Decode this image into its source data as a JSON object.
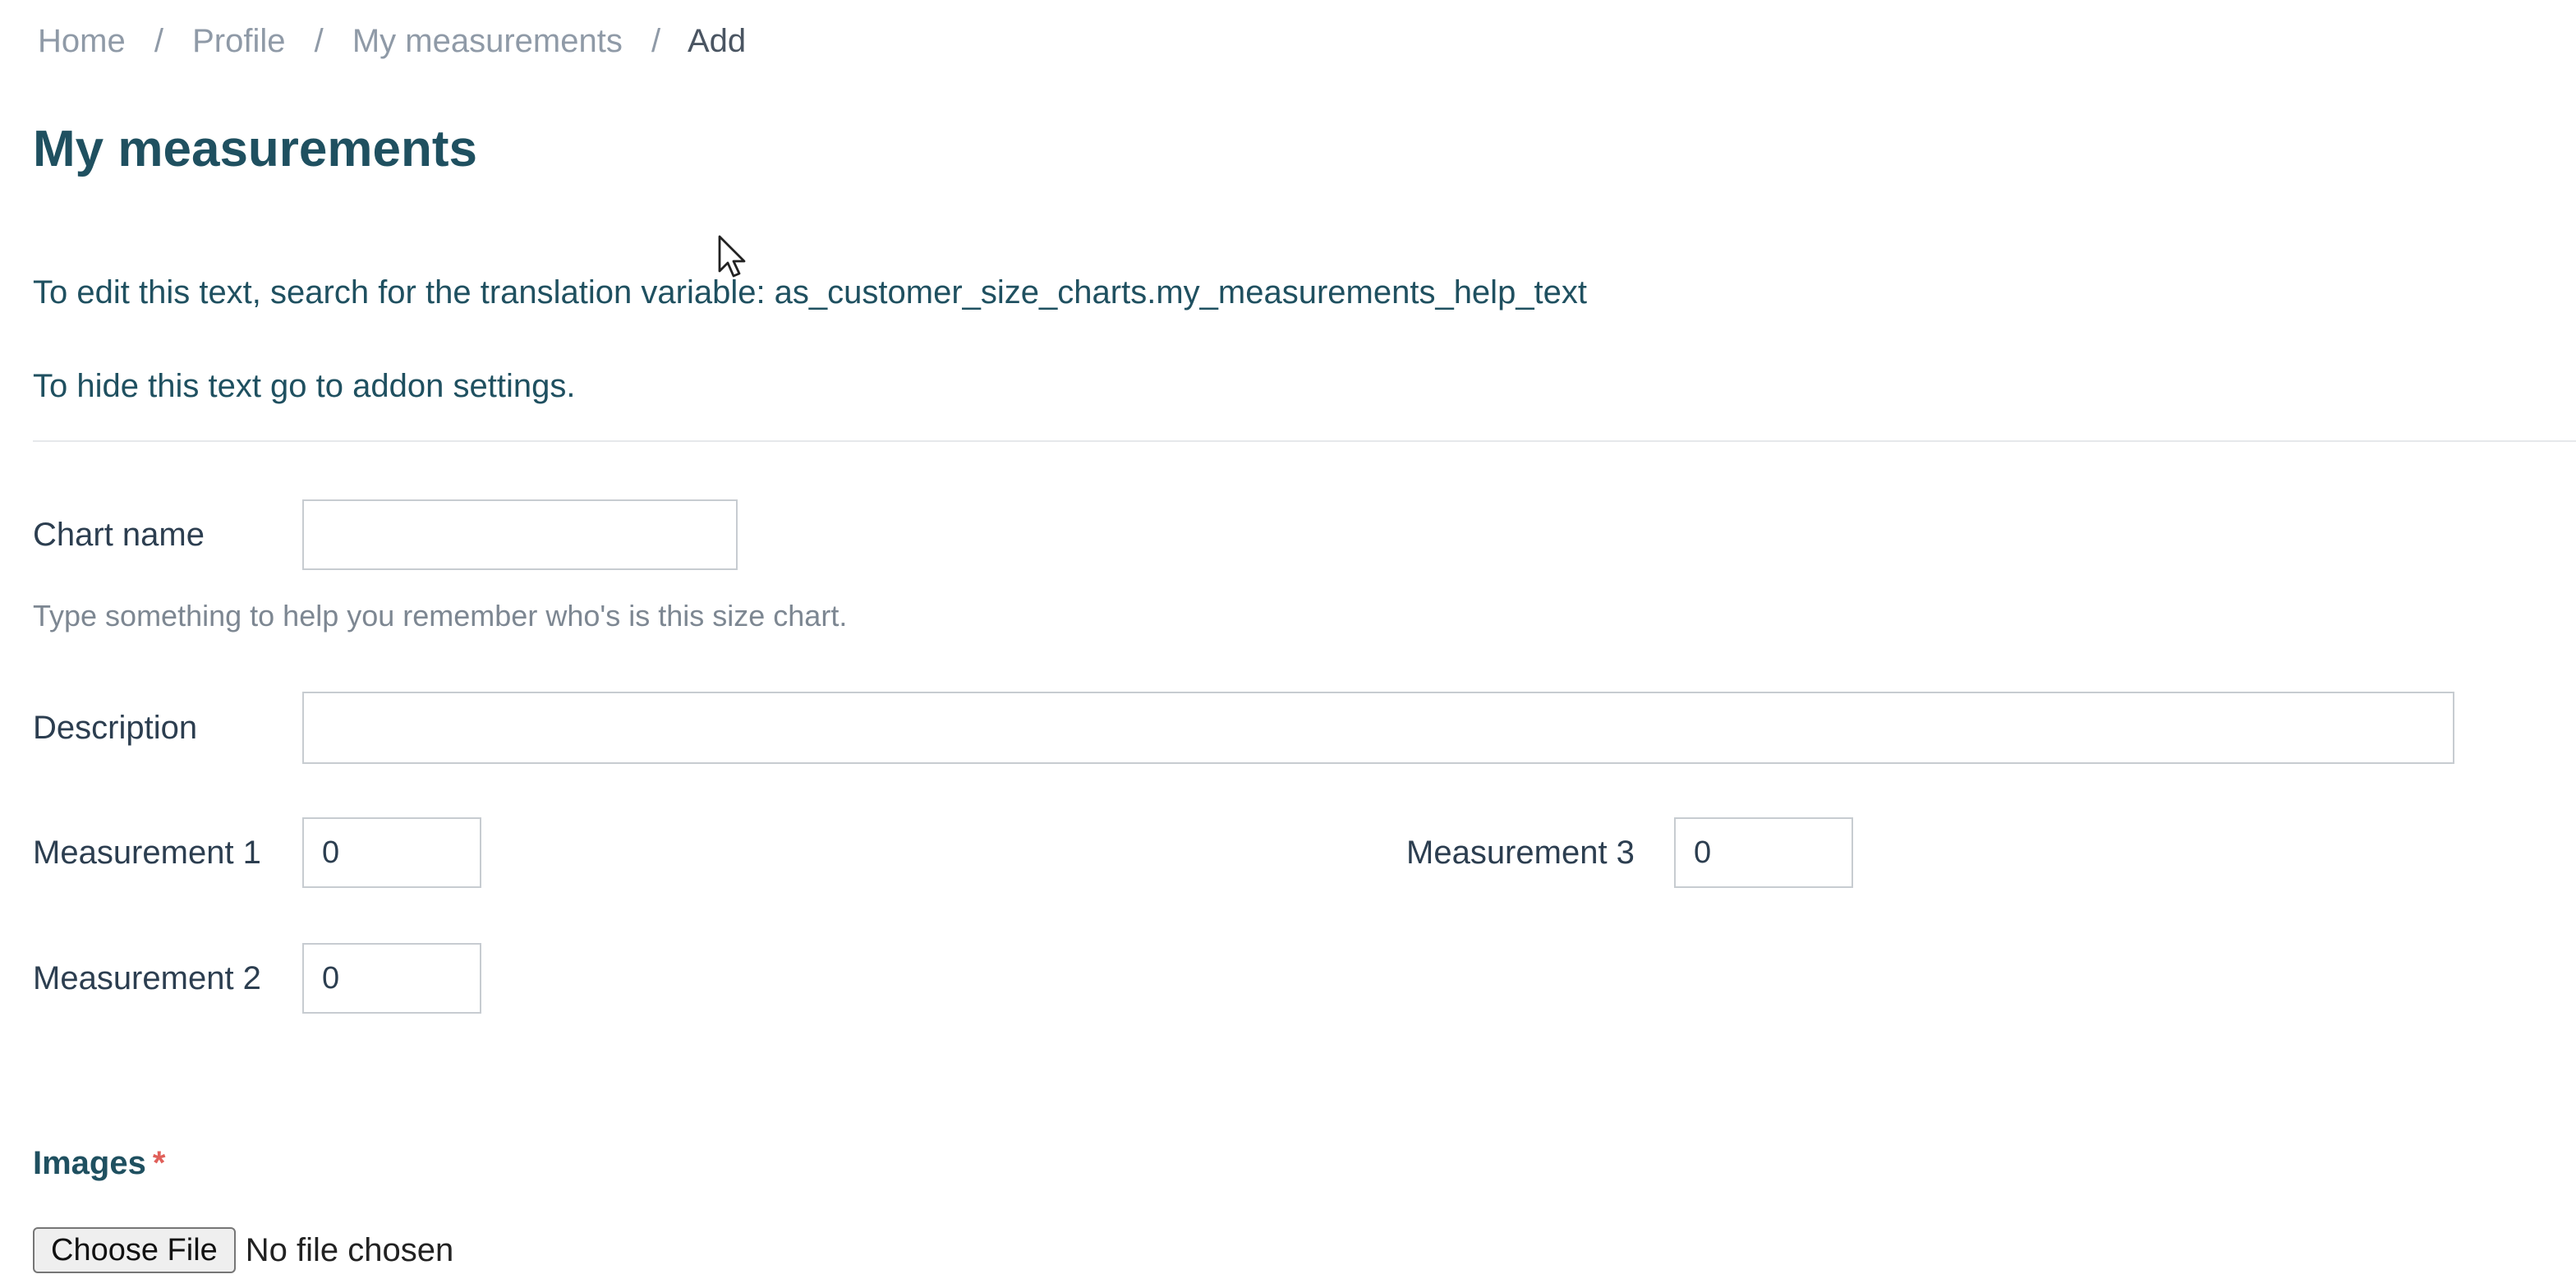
{
  "breadcrumb": {
    "items": [
      "Home",
      "Profile",
      "My measurements"
    ],
    "separator": "/",
    "current": "Add"
  },
  "page": {
    "title": "My measurements",
    "help_text": "To edit this text, search for the translation variable: as_customer_size_charts.my_measurements_help_text",
    "hide_text": "To hide this text go to addon settings."
  },
  "form": {
    "chart_name": {
      "label": "Chart name",
      "value": "",
      "hint": "Type something to help you remember who's is this size chart."
    },
    "description": {
      "label": "Description",
      "value": ""
    },
    "measurement_1": {
      "label": "Measurement 1",
      "value": "0"
    },
    "measurement_2": {
      "label": "Measurement 2",
      "value": "0"
    },
    "measurement_3": {
      "label": "Measurement 3",
      "value": "0"
    },
    "images": {
      "label": "Images",
      "required_marker": "*",
      "button_label": "Choose File",
      "status": "No file chosen"
    }
  },
  "colors": {
    "heading": "#1f5060",
    "breadcrumb": "#8f9aa7",
    "required": "#e0605a",
    "input_border": "#c7ccd1"
  },
  "icons": {
    "cursor": "mouse-pointer-icon"
  }
}
